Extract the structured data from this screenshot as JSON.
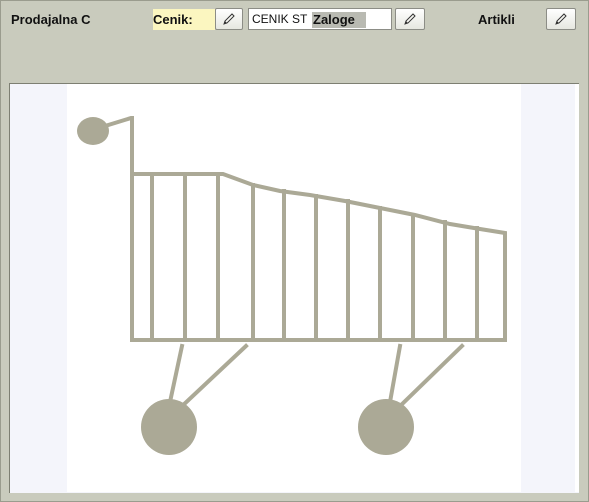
{
  "header": {
    "prodajalna_label": "Prodajalna C",
    "cenik_label": "Cenik:",
    "cenik_value": "CENIK ST",
    "zaloge_label": "Zaloge",
    "artikli_label": "Artikli"
  },
  "icons": {
    "edit": "pencil-icon",
    "cart": "shopping-cart-icon"
  },
  "colors": {
    "background": "#c9cbbd",
    "cenik_highlight": "#fbf6c0",
    "cart_color": "#aba996"
  }
}
